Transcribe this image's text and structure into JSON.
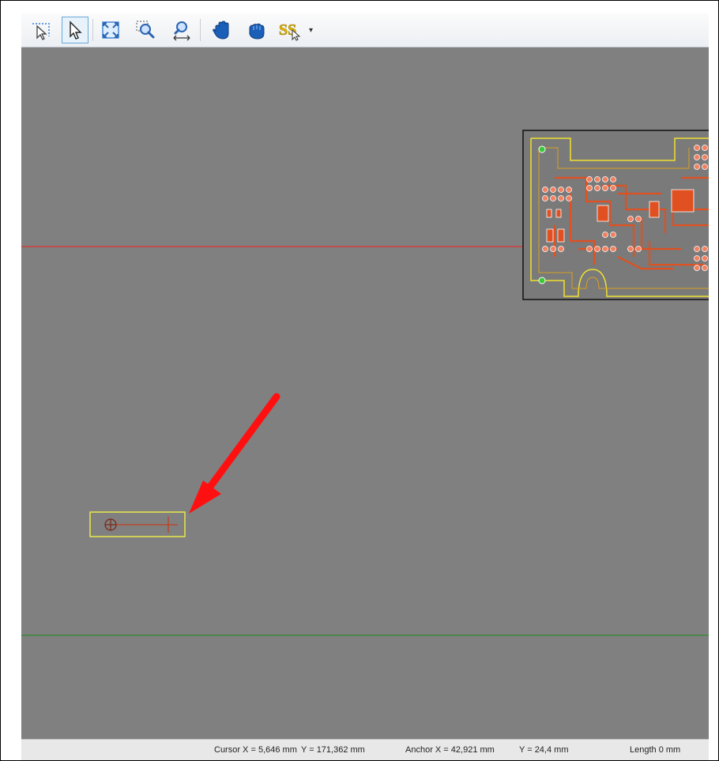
{
  "toolbar": {
    "buttons": [
      {
        "name": "lasso-select-icon"
      },
      {
        "name": "arrow-select-icon",
        "active": true
      },
      {
        "name": "zoom-fit-icon"
      },
      {
        "name": "zoom-window-icon"
      },
      {
        "name": "zoom-pan-icon"
      },
      {
        "name": "hand-pan-icon"
      },
      {
        "name": "hand-grab-icon"
      },
      {
        "name": "snap-tool-icon"
      }
    ]
  },
  "canvas": {
    "background": "#808080",
    "guide_red_color": "#e03030",
    "guide_green_color": "#2e8b2e",
    "selection_color": "#e8e84a"
  },
  "status": {
    "cursor_x_label": "Cursor X =",
    "cursor_x_value": "5,646 mm",
    "cursor_y_label": "Y =",
    "cursor_y_value": "171,362 mm",
    "anchor_x_label": "Anchor X =",
    "anchor_x_value": "42,921 mm",
    "anchor_y_label": "Y =",
    "anchor_y_value": "24,4 mm",
    "length_label": "Length",
    "length_value": "0 mm"
  }
}
